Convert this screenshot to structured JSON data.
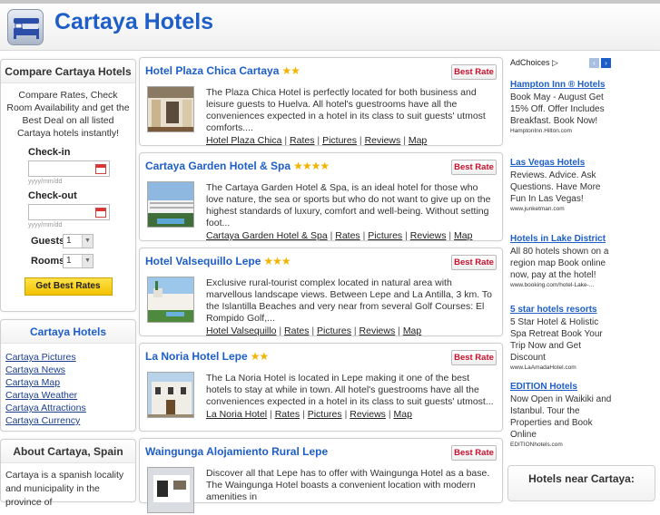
{
  "site": {
    "title": "Cartaya Hotels",
    "accent": "#1e5ec8"
  },
  "compare": {
    "heading": "Compare Cartaya Hotels",
    "text": "Compare Rates, Check Room Availability and get the Best Deal on all listed Cartaya hotels instantly!",
    "checkin_label": "Check-in",
    "checkout_label": "Check-out",
    "date_hint": "yyyy/mm/dd",
    "guests_label": "Guests",
    "guests_value": "1",
    "rooms_label": "Rooms",
    "rooms_value": "1",
    "button": "Get Best Rates"
  },
  "city_box": {
    "heading": "Cartaya Hotels",
    "links": [
      "Cartaya Pictures",
      "Cartaya News",
      "Cartaya Map",
      "Cartaya Weather",
      "Cartaya Attractions",
      "Cartaya Currency"
    ]
  },
  "about": {
    "heading": "About Cartaya, Spain",
    "text": "Cartaya is a spanish locality and municipality in the province of"
  },
  "hotels": [
    {
      "name": "Hotel Plaza Chica Cartaya",
      "stars": "★★",
      "rate_label": "Best Rate",
      "desc": "The Plaza Chica Hotel is perfectly located for both business and leisure guests to Huelva. All hotel's guestrooms have all the conveniences expected in a hotel in its class to suit guests' utmost comforts....",
      "link_name": "Hotel Plaza Chica",
      "link_rates": "Rates",
      "link_pictures": "Pictures",
      "link_reviews": "Reviews",
      "link_map": "Map"
    },
    {
      "name": "Cartaya Garden Hotel & Spa",
      "stars": "★★★★",
      "rate_label": "Best Rate",
      "desc": "The Cartaya Garden Hotel & Spa, is an ideal hotel for those who love nature, the sea or sports but who do not want to give up on the highest standards of luxury, comfort and well-being. Without setting foot...",
      "link_name": "Cartaya Garden Hotel & Spa",
      "link_rates": "Rates",
      "link_pictures": "Pictures",
      "link_reviews": "Reviews",
      "link_map": "Map"
    },
    {
      "name": "Hotel Valsequillo Lepe",
      "stars": "★★★",
      "rate_label": "Best Rate",
      "desc": "Exclusive rural-tourist complex located in natural area with marvellous landscape views. Between Lepe and La Antilla, 3 km. To the Islantilla Beaches and very near from several Golf Courses: El Rompido Golf,...",
      "link_name": "Hotel Valsequillo",
      "link_rates": "Rates",
      "link_pictures": "Pictures",
      "link_reviews": "Reviews",
      "link_map": "Map"
    },
    {
      "name": "La Noria Hotel Lepe",
      "stars": "★★",
      "rate_label": "Best Rate",
      "desc": "The La Noria Hotel is located in Lepe making it one of the best hotels to stay at while in town. All hotel's guestrooms have all the conveniences expected in a hotel in its class to suit guests' utmost...",
      "link_name": "La Noria Hotel",
      "link_rates": "Rates",
      "link_pictures": "Pictures",
      "link_reviews": "Reviews",
      "link_map": "Map"
    },
    {
      "name": "Waingunga Alojamiento Rural Lepe",
      "stars": "",
      "rate_label": "Best Rate",
      "desc": "Discover all that Lepe has to offer with Waingunga Hotel as a base. The Waingunga Hotel boasts a convenient location with modern amenities in",
      "link_name": "",
      "link_rates": "",
      "link_pictures": "",
      "link_reviews": "",
      "link_map": ""
    }
  ],
  "ads": {
    "adchoices": "AdChoices",
    "items": [
      {
        "title": "Hampton Inn ® Hotels",
        "body": "Book May - August Get 15% Off. Offer Includes Breakfast. Book Now!",
        "url": "HamptonInn.Hilton.com"
      },
      {
        "title": "Las Vegas Hotels",
        "body": "Reviews. Advice. Ask Questions. Have More Fun In Las Vegas!",
        "url": "www.junketman.com"
      },
      {
        "title": "Hotels in Lake District",
        "body": "All 80 hotels shown on a region map Book online now, pay at the hotel!",
        "url": "www.booking.com/hotel-Lake-..."
      },
      {
        "title": "5 star hotels resorts",
        "body": "5 Star Hotel & Holistic Spa Retreat Book Your Trip Now and Get Discount",
        "url": "www.LaAmadaHotel.com"
      },
      {
        "title": "EDITION Hotels",
        "body": "Now Open in Waikiki and Istanbul. Tour the Properties and Book Online",
        "url": "EDITIONhotels.com"
      }
    ]
  },
  "near": {
    "heading": "Hotels near Cartaya:"
  }
}
